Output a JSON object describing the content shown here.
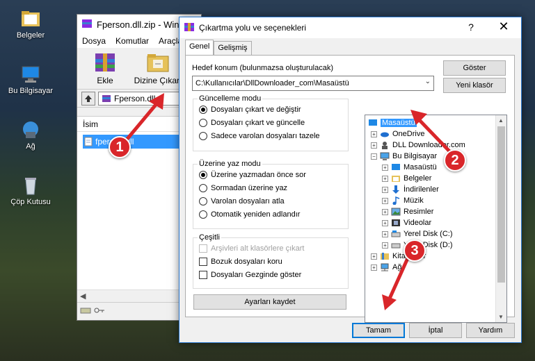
{
  "desktop": {
    "icons": [
      {
        "label": "Belgeler",
        "icon": "folder-icon"
      },
      {
        "label": "Bu Bilgisayar",
        "icon": "computer-icon"
      },
      {
        "label": "Ağ",
        "icon": "network-icon"
      },
      {
        "label": "Çöp Kutusu",
        "icon": "recycle-bin-icon"
      }
    ]
  },
  "winrar": {
    "title": "Fperson.dll.zip - Win",
    "menu": [
      "Dosya",
      "Komutlar",
      "Araçla"
    ],
    "toolbar": {
      "add_label": "Ekle",
      "extract_label": "Dizine Çıkart"
    },
    "path": "Fperson.dll",
    "column_name": "İsim",
    "file_name": "fperson.dll"
  },
  "dialog": {
    "title": "Çıkartma yolu ve seçenekleri",
    "help_glyph": "?",
    "close_glyph": "✕",
    "tabs": [
      "Genel",
      "Gelişmiş"
    ],
    "dest_label": "Hedef konum (bulunmazsa oluşturulacak)",
    "dest_value": "C:\\Kullanıcılar\\DllDownloader_com\\Masaüstü",
    "show_button": "Göster",
    "new_folder_button": "Yeni klasör",
    "update_group": {
      "title": "Güncelleme modu",
      "options": [
        "Dosyaları çıkart ve değiştir",
        "Dosyaları çıkart ve güncelle",
        "Sadece varolan dosyaları tazele"
      ],
      "selected": 0
    },
    "overwrite_group": {
      "title": "Üzerine yaz modu",
      "options": [
        "Üzerine yazmadan önce sor",
        "Sormadan üzerine yaz",
        "Varolan dosyaları atla",
        "Otomatik yeniden adlandır"
      ],
      "selected": 0
    },
    "misc_group": {
      "title": "Çeşitli",
      "options": [
        "Arşivleri alt klasörlere çıkart",
        "Bozuk dosyaları koru",
        "Dosyaları Gezginde göster"
      ]
    },
    "save_settings_button": "Ayarları kaydet",
    "tree": [
      "Masaüstü",
      "OneDrive",
      "DLL Downloader.com",
      "Bu Bilgisayar",
      "Masaüstü",
      "Belgeler",
      "İndirilenler",
      "Müzik",
      "Resimler",
      "Videolar",
      "Yerel Disk (C:)",
      "Yerel Disk (D:)",
      "Kitaplıklar",
      "Ağ"
    ],
    "ok_button": "Tamam",
    "cancel_button": "İptal",
    "help_button": "Yardım"
  },
  "markers": [
    "1",
    "2",
    "3"
  ],
  "colors": {
    "marker": "#d9262a",
    "selection": "#3399ff",
    "accent": "#0078d7"
  }
}
